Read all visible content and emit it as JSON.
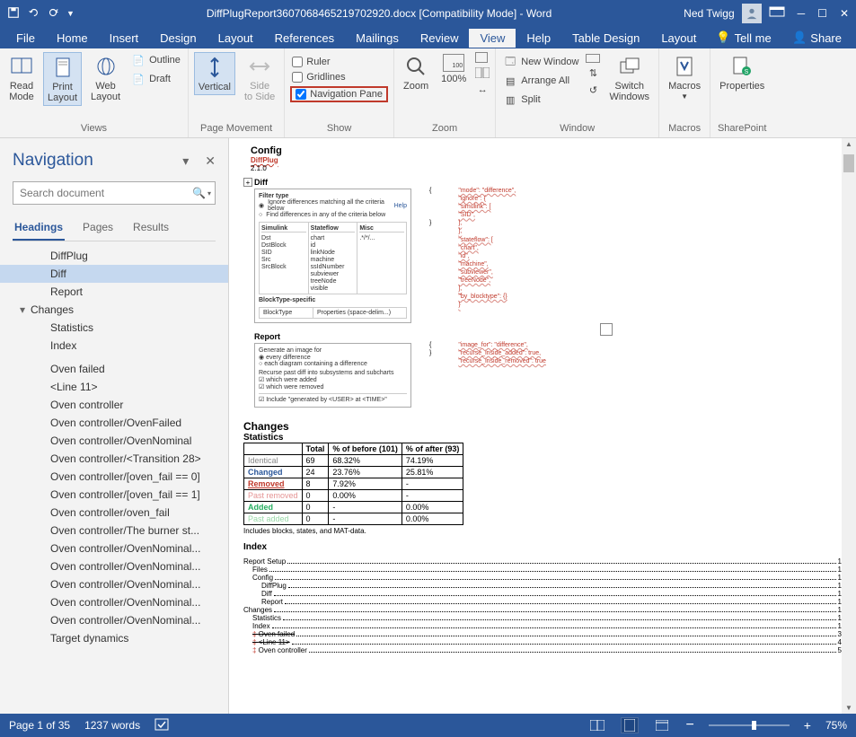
{
  "titlebar": {
    "doc_title": "DiffPlugReport36070684652197029​20.docx [Compatibility Mode]  -  Word",
    "user_name": "Ned Twigg"
  },
  "tabs": {
    "file": "File",
    "home": "Home",
    "insert": "Insert",
    "design": "Design",
    "layout": "Layout",
    "references": "References",
    "mailings": "Mailings",
    "review": "Review",
    "view": "View",
    "help": "Help",
    "table_design": "Table Design",
    "layout2": "Layout",
    "tell_me": "Tell me",
    "share": "Share"
  },
  "ribbon": {
    "views": {
      "read_mode": "Read\nMode",
      "print_layout": "Print\nLayout",
      "web_layout": "Web\nLayout",
      "outline": "Outline",
      "draft": "Draft",
      "label": "Views"
    },
    "page_movement": {
      "vertical": "Vertical",
      "side_to_side": "Side\nto Side",
      "label": "Page Movement"
    },
    "show": {
      "ruler": "Ruler",
      "gridlines": "Gridlines",
      "navigation_pane": "Navigation Pane",
      "label": "Show"
    },
    "zoom": {
      "zoom": "Zoom",
      "hundred": "100%",
      "label": "Zoom"
    },
    "window": {
      "new_window": "New Window",
      "arrange_all": "Arrange All",
      "split": "Split",
      "switch_windows": "Switch\nWindows",
      "label": "Window"
    },
    "macros": {
      "macros": "Macros",
      "label": "Macros"
    },
    "sharepoint": {
      "properties": "Properties",
      "label": "SharePoint"
    }
  },
  "nav": {
    "title": "Navigation",
    "search_placeholder": "Search document",
    "tabs": {
      "headings": "Headings",
      "pages": "Pages",
      "results": "Results"
    },
    "items": [
      {
        "text": "DiffPlug",
        "level": 1
      },
      {
        "text": "Diff",
        "level": 1,
        "selected": true
      },
      {
        "text": "Report",
        "level": 1
      },
      {
        "text": "Changes",
        "level": 0,
        "caret": "▾"
      },
      {
        "text": "Statistics",
        "level": 1
      },
      {
        "text": "Index",
        "level": 1
      },
      {
        "text": " ",
        "level": 1
      },
      {
        "text": "Oven failed",
        "level": 1
      },
      {
        "text": "<Line 11>",
        "level": 1
      },
      {
        "text": "Oven controller",
        "level": 1
      },
      {
        "text": "Oven controller/OvenFailed",
        "level": 1
      },
      {
        "text": "Oven controller/OvenNominal",
        "level": 1
      },
      {
        "text": "Oven controller/<Transition 28>",
        "level": 1
      },
      {
        "text": "Oven controller/[oven_fail == 0]",
        "level": 1
      },
      {
        "text": "Oven controller/[oven_fail == 1]",
        "level": 1
      },
      {
        "text": "Oven controller/oven_fail",
        "level": 1
      },
      {
        "text": "Oven controller/The burner st...",
        "level": 1
      },
      {
        "text": "Oven controller/OvenNominal...",
        "level": 1
      },
      {
        "text": "Oven controller/OvenNominal...",
        "level": 1
      },
      {
        "text": "Oven controller/OvenNominal...",
        "level": 1
      },
      {
        "text": "Oven controller/OvenNominal...",
        "level": 1
      },
      {
        "text": "Oven controller/OvenNominal...",
        "level": 1
      },
      {
        "text": "Target dynamics",
        "level": 1
      }
    ]
  },
  "doc": {
    "config": "Config",
    "diffplug": "DiffPlug",
    "version": "2.1.0",
    "diff": "Diff",
    "filter": {
      "title": "Filter type",
      "opt1": "Ignore differences matching all the criteria below",
      "opt2": "Find differences in any of the criteria below",
      "help": "Help",
      "simulink": {
        "hd": "Simulink",
        "items": [
          "Dst",
          "DstBlock",
          "SID",
          "Src",
          "SrcBlock"
        ]
      },
      "stateflow": {
        "hd": "Stateflow",
        "items": [
          "chart",
          "id",
          "linkNode",
          "machine",
          "ssIdNumber",
          "subviewer",
          "treeNode",
          "visible"
        ]
      },
      "misc": {
        "hd": "Misc",
        "items": [
          ".*/*/..."
        ]
      },
      "bt_title": "BlockType-specific",
      "bt_col1": "BlockType",
      "bt_col2": "Properties (space-delim...)"
    },
    "code_right1": [
      "\"mode\": \"difference\",",
      "\"ignore\": {",
      "  \"simulink\": [",
      "     \"SID\",",
      "   ],",
      "  ],",
      "  \"stateflow\": [",
      "     \"chart\",",
      "     \"id\",",
      "     \"machine\",",
      "     \"subviewer\",",
      "     \"treeNode\",",
      "  ],",
      "  \"by_blocktype\": {}",
      "}"
    ],
    "report_title": "Report",
    "report": {
      "gen": "Generate an image for",
      "r1": "every difference",
      "r2": "each diagram containing a difference",
      "recurse": "Recurse past diff into subsystems and subcharts",
      "c1": "which were added",
      "c2": "which were removed",
      "inc": "Include \"generated by <USER> at <TIME>\""
    },
    "code_right2": [
      "\"image_for\": \"difference\",",
      "\"recurse_inside_added\": true,",
      "\"recurse_inside_removed\": true"
    ],
    "changes": "Changes",
    "statistics": "Statistics",
    "stats_headers": [
      "",
      "Total",
      "% of before (101)",
      "% of after (93)"
    ],
    "stats_rows": [
      {
        "label": "Identical",
        "cls": "st-identical",
        "total": "69",
        "before": "68.32%",
        "after": "74.19%"
      },
      {
        "label": "Changed",
        "cls": "st-changed",
        "total": "24",
        "before": "23.76%",
        "after": "25.81%"
      },
      {
        "label": "Removed",
        "cls": "st-removed",
        "total": "8",
        "before": "7.92%",
        "after": "-"
      },
      {
        "label": "Past removed",
        "cls": "st-pastrem",
        "total": "0",
        "before": "0.00%",
        "after": "-"
      },
      {
        "label": "Added",
        "cls": "st-added",
        "total": "0",
        "before": "-",
        "after": "0.00%"
      },
      {
        "label": "Past added",
        "cls": "st-pastadd",
        "total": "0",
        "before": "-",
        "after": "0.00%"
      }
    ],
    "stats_note": "Includes blocks, states, and MAT-data.",
    "index_title": "Index",
    "index": [
      {
        "lbl": "Report Setup",
        "pg": "1",
        "lvl": 0
      },
      {
        "lbl": "Files",
        "pg": "1",
        "lvl": 1
      },
      {
        "lbl": "Config",
        "pg": "1",
        "lvl": 1
      },
      {
        "lbl": "DiffPlug",
        "pg": "1",
        "lvl": 2
      },
      {
        "lbl": "Diff",
        "pg": "1",
        "lvl": 2
      },
      {
        "lbl": "Report",
        "pg": "1",
        "lvl": 2
      },
      {
        "lbl": "Changes",
        "pg": "1",
        "lvl": 0
      },
      {
        "lbl": "Statistics",
        "pg": "1",
        "lvl": 1
      },
      {
        "lbl": "Index",
        "pg": "1",
        "lvl": 1
      },
      {
        "lbl": "Oven failed",
        "pg": "3",
        "lvl": 1,
        "strike": true,
        "marker": true
      },
      {
        "lbl": "<Line 11>",
        "pg": "4",
        "lvl": 1,
        "strike": true,
        "marker": true
      },
      {
        "lbl": "Oven controller",
        "pg": "5",
        "lvl": 1,
        "marker": true
      }
    ]
  },
  "status": {
    "page": "Page 1 of 35",
    "words": "1237 words",
    "zoom": "75%"
  }
}
